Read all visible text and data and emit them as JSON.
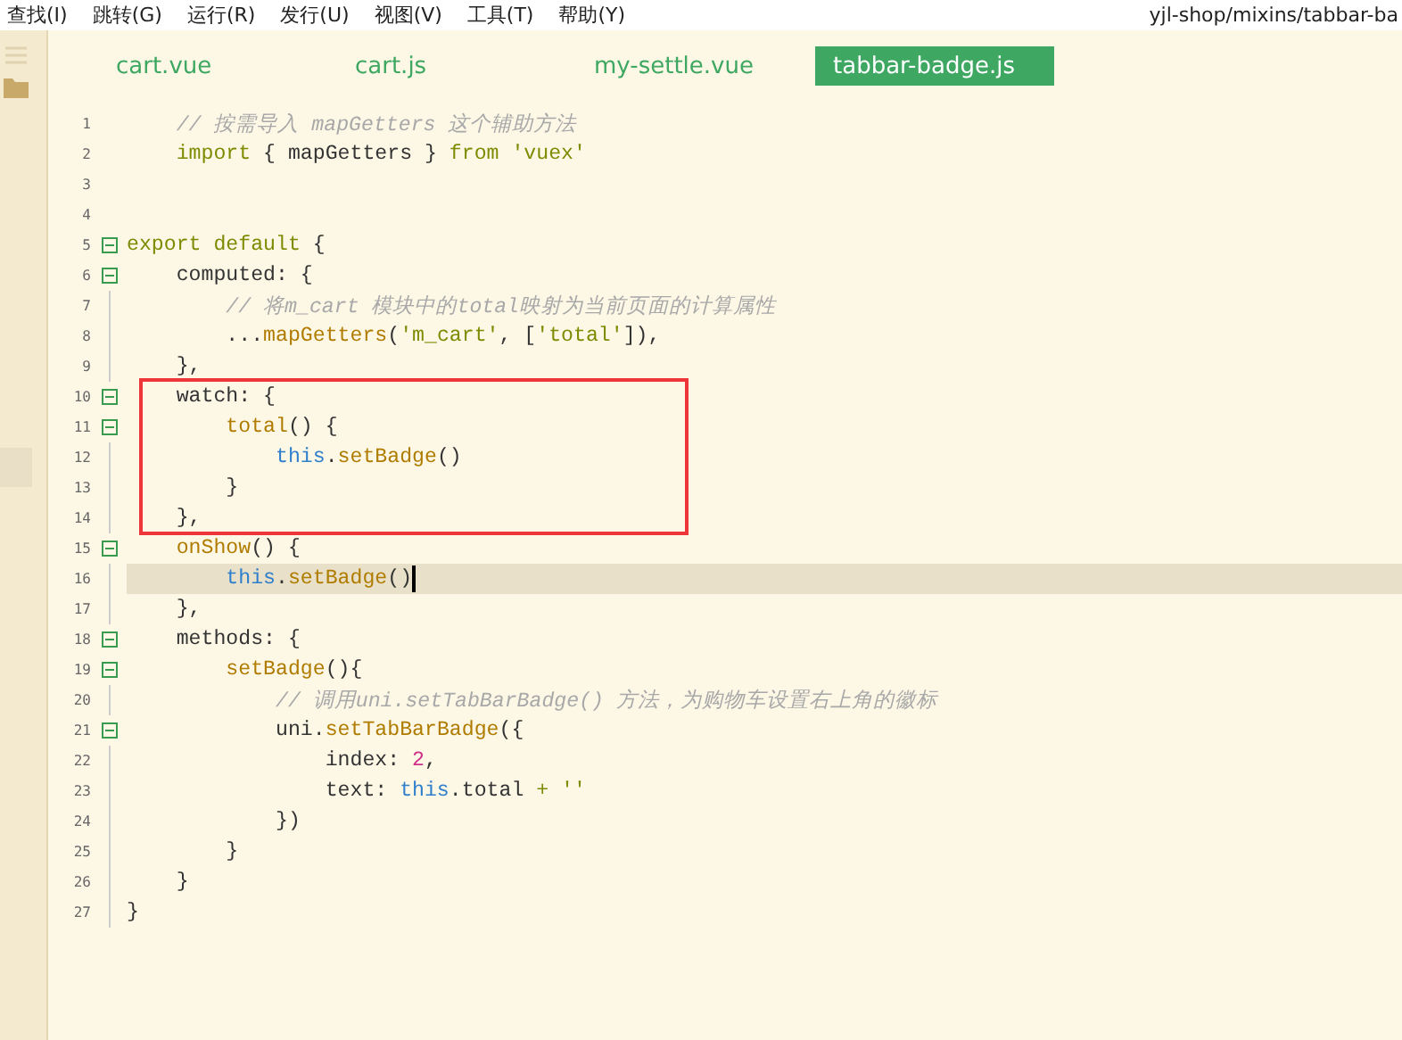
{
  "menu_bar": {
    "items": [
      "查找(I)",
      "跳转(G)",
      "运行(R)",
      "发行(U)",
      "视图(V)",
      "工具(T)",
      "帮助(Y)"
    ],
    "path": "yjl-shop/mixins/tabbar-ba"
  },
  "tabs": [
    {
      "label": "cart.vue",
      "selected": false
    },
    {
      "label": "cart.js",
      "selected": false
    },
    {
      "label": "my-settle.vue",
      "selected": false
    },
    {
      "label": "tabbar-badge.js",
      "selected": true
    }
  ],
  "editor": {
    "blocks": [
      {
        "boxed": false,
        "lines": [
          {
            "number": "1",
            "foldable": false,
            "current": false,
            "tokens": [
              {
                "text": "    // 按需导入 mapGetters 这个辅助方法",
                "kind": "comment"
              }
            ]
          },
          {
            "number": "2",
            "foldable": false,
            "current": false,
            "tokens": [
              {
                "text": "    import",
                "kind": "keyword"
              },
              {
                "text": " { mapGetters } ",
                "kind": "plain"
              },
              {
                "text": "from",
                "kind": "keyword"
              },
              {
                "text": " 'vuex'",
                "kind": "string"
              }
            ]
          },
          {
            "number": "3",
            "foldable": false,
            "current": false
          },
          {
            "number": "4",
            "foldable": false,
            "current": false
          },
          {
            "number": "5",
            "foldable": true,
            "current": false,
            "tokens": [
              {
                "text": "export default",
                "kind": "keyword"
              },
              {
                "text": " {",
                "kind": "plain"
              }
            ]
          },
          {
            "number": "6",
            "foldable": true,
            "current": false,
            "tokens": [
              {
                "text": "    computed: {",
                "kind": "plain"
              }
            ]
          },
          {
            "number": "7",
            "foldable": false,
            "current": false,
            "tokens": [
              {
                "text": "        // 将m_cart 模块中的total映射为当前页面的计算属性",
                "kind": "comment"
              }
            ]
          },
          {
            "number": "8",
            "foldable": false,
            "current": false,
            "tokens": [
              {
                "text": "        ...",
                "kind": "plain"
              },
              {
                "text": "mapGetters",
                "kind": "function"
              },
              {
                "text": "(",
                "kind": "plain"
              },
              {
                "text": "'m_cart'",
                "kind": "string"
              },
              {
                "text": ", [",
                "kind": "plain"
              },
              {
                "text": "'total'",
                "kind": "string"
              },
              {
                "text": "]),",
                "kind": "plain"
              }
            ]
          },
          {
            "number": "9",
            "foldable": false,
            "current": false,
            "tokens": [
              {
                "text": "    },",
                "kind": "plain"
              }
            ]
          }
        ]
      },
      {
        "boxed": true,
        "lines": [
          {
            "number": "10",
            "foldable": true,
            "current": false,
            "tokens": [
              {
                "text": "    watch: {",
                "kind": "plain"
              }
            ]
          },
          {
            "number": "11",
            "foldable": true,
            "current": false,
            "tokens": [
              {
                "text": "        total",
                "kind": "function"
              },
              {
                "text": "() {",
                "kind": "plain"
              }
            ]
          },
          {
            "number": "12",
            "foldable": false,
            "current": false,
            "tokens": [
              {
                "text": "            this",
                "kind": "this"
              },
              {
                "text": ".",
                "kind": "plain"
              },
              {
                "text": "setBadge",
                "kind": "function"
              },
              {
                "text": "()",
                "kind": "plain"
              }
            ]
          },
          {
            "number": "13",
            "foldable": false,
            "current": false,
            "tokens": [
              {
                "text": "        }",
                "kind": "plain"
              }
            ]
          },
          {
            "number": "14",
            "foldable": false,
            "current": false,
            "tokens": [
              {
                "text": "    },",
                "kind": "plain"
              }
            ]
          }
        ]
      },
      {
        "boxed": false,
        "lines": [
          {
            "number": "15",
            "foldable": true,
            "current": false,
            "tokens": [
              {
                "text": "    onShow",
                "kind": "function"
              },
              {
                "text": "() {",
                "kind": "plain"
              }
            ]
          },
          {
            "number": "16",
            "foldable": false,
            "current": true,
            "tokens": [
              {
                "text": "        this",
                "kind": "this"
              },
              {
                "text": ".",
                "kind": "plain"
              },
              {
                "text": "setBadge",
                "kind": "function"
              },
              {
                "text": "()",
                "kind": "plain"
              }
            ]
          },
          {
            "number": "17",
            "foldable": false,
            "current": false,
            "tokens": [
              {
                "text": "    },",
                "kind": "plain"
              }
            ]
          },
          {
            "number": "18",
            "foldable": true,
            "current": false,
            "tokens": [
              {
                "text": "    methods: {",
                "kind": "plain"
              }
            ]
          },
          {
            "number": "19",
            "foldable": true,
            "current": false,
            "tokens": [
              {
                "text": "        setBadge",
                "kind": "function"
              },
              {
                "text": "(){",
                "kind": "plain"
              }
            ]
          },
          {
            "number": "20",
            "foldable": false,
            "current": false,
            "tokens": [
              {
                "text": "            // 调用uni.setTabBarBadge() 方法，为购物车设置右上角的徽标",
                "kind": "comment"
              }
            ]
          },
          {
            "number": "21",
            "foldable": true,
            "current": false,
            "tokens": [
              {
                "text": "            uni.",
                "kind": "plain"
              },
              {
                "text": "setTabBarBadge",
                "kind": "function"
              },
              {
                "text": "({",
                "kind": "plain"
              }
            ]
          },
          {
            "number": "22",
            "foldable": false,
            "current": false,
            "tokens": [
              {
                "text": "                index: ",
                "kind": "plain"
              },
              {
                "text": "2",
                "kind": "number"
              },
              {
                "text": ",",
                "kind": "plain"
              }
            ]
          },
          {
            "number": "23",
            "foldable": false,
            "current": false,
            "tokens": [
              {
                "text": "                text: ",
                "kind": "plain"
              },
              {
                "text": "this",
                "kind": "this"
              },
              {
                "text": ".total ",
                "kind": "plain"
              },
              {
                "text": "+",
                "kind": "keyword"
              },
              {
                "text": " ''",
                "kind": "string"
              }
            ]
          },
          {
            "number": "24",
            "foldable": false,
            "current": false,
            "tokens": [
              {
                "text": "            })",
                "kind": "plain"
              }
            ]
          },
          {
            "number": "25",
            "foldable": false,
            "current": false,
            "tokens": [
              {
                "text": "        }",
                "kind": "plain"
              }
            ]
          },
          {
            "number": "26",
            "foldable": false,
            "current": false,
            "tokens": [
              {
                "text": "    }",
                "kind": "plain"
              }
            ]
          },
          {
            "number": "27",
            "foldable": false,
            "current": false,
            "tokens": [
              {
                "text": "}",
                "kind": "plain"
              }
            ]
          }
        ]
      }
    ]
  }
}
